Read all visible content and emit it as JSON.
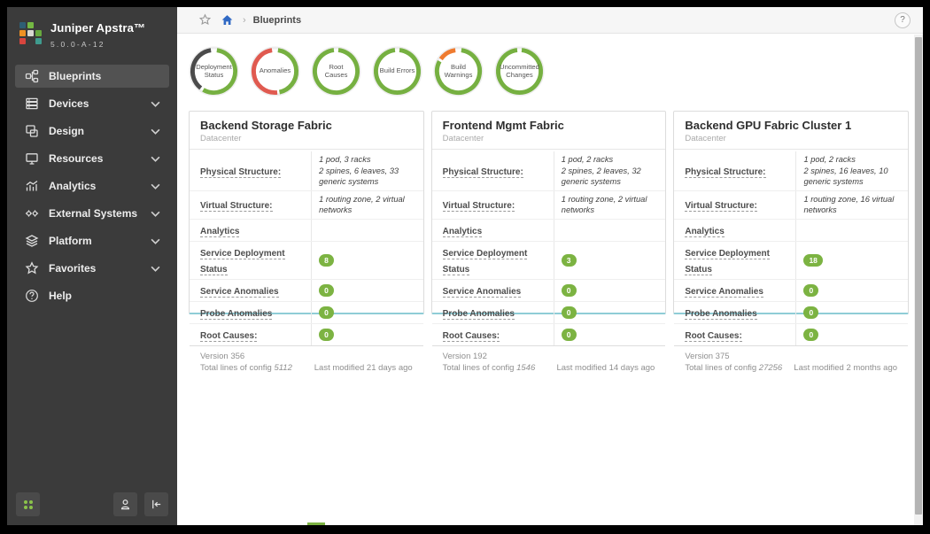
{
  "app": {
    "brand": "Juniper Apstra™",
    "version": "5.0.0-A-12"
  },
  "breadcrumb": {
    "page": "Blueprints",
    "separator": "›"
  },
  "topbar": {
    "help_label": "?"
  },
  "sidebar": {
    "items": [
      {
        "label": "Blueprints"
      },
      {
        "label": "Devices"
      },
      {
        "label": "Design"
      },
      {
        "label": "Resources"
      },
      {
        "label": "Analytics"
      },
      {
        "label": "External Systems"
      },
      {
        "label": "Platform"
      },
      {
        "label": "Favorites"
      },
      {
        "label": "Help"
      }
    ]
  },
  "colors": {
    "accent_green": "#7cb342",
    "ring_green": "#76b041",
    "ring_red": "#e05a50",
    "ring_orange": "#ef7b30",
    "ring_dark": "#4b4b4b",
    "home_blue": "#3069c4",
    "card_bottom_edge": "#8fcdd6"
  },
  "status_rings": [
    {
      "label": "Deployment Status",
      "segments": [
        {
          "color": "#76b041",
          "start": 8,
          "end": 210
        },
        {
          "color": "#4b4b4b",
          "start": 218,
          "end": 352
        }
      ]
    },
    {
      "label": "Anomalies",
      "segments": [
        {
          "color": "#76b041",
          "start": 8,
          "end": 168
        },
        {
          "color": "#e05a50",
          "start": 174,
          "end": 352
        }
      ]
    },
    {
      "label": "Root Causes",
      "segments": [
        {
          "color": "#76b041",
          "start": 6,
          "end": 354
        }
      ]
    },
    {
      "label": "Build Errors",
      "segments": [
        {
          "color": "#76b041",
          "start": 6,
          "end": 354
        }
      ]
    },
    {
      "label": "Build Warnings",
      "segments": [
        {
          "color": "#76b041",
          "start": 8,
          "end": 298
        },
        {
          "color": "#ef7b30",
          "start": 305,
          "end": 352
        }
      ]
    },
    {
      "label": "Uncommitted Changes",
      "segments": [
        {
          "color": "#76b041",
          "start": 6,
          "end": 354
        }
      ]
    }
  ],
  "cards": [
    {
      "title": "Backend Storage Fabric",
      "subtitle": "Datacenter",
      "rows": [
        {
          "label": "Physical Structure:",
          "value_lines": [
            "1 pod, 3 racks",
            "2 spines, 6 leaves, 33 generic systems"
          ]
        },
        {
          "label": "Virtual Structure:",
          "value_lines": [
            "1 routing zone, 2 virtual networks"
          ]
        },
        {
          "label": "Analytics"
        },
        {
          "label": "Service Deployment Status",
          "badge": "8"
        },
        {
          "label": "Service Anomalies",
          "badge": "0"
        },
        {
          "label": "Probe Anomalies",
          "badge": "0"
        },
        {
          "label": "Root Causes:",
          "badge": "0"
        }
      ],
      "footer": {
        "version": "Version 356",
        "config_label": "Total lines of config",
        "config_value": "5112",
        "modified": "Last modified 21 days ago"
      }
    },
    {
      "title": "Frontend Mgmt Fabric",
      "subtitle": "Datacenter",
      "rows": [
        {
          "label": "Physical Structure:",
          "value_lines": [
            "1 pod, 2 racks",
            "2 spines, 2 leaves, 32 generic systems"
          ]
        },
        {
          "label": "Virtual Structure:",
          "value_lines": [
            "1 routing zone, 2 virtual networks"
          ]
        },
        {
          "label": "Analytics"
        },
        {
          "label": "Service Deployment Status",
          "badge": "3"
        },
        {
          "label": "Service Anomalies",
          "badge": "0"
        },
        {
          "label": "Probe Anomalies",
          "badge": "0"
        },
        {
          "label": "Root Causes:",
          "badge": "0"
        }
      ],
      "footer": {
        "version": "Version 192",
        "config_label": "Total lines of config",
        "config_value": "1546",
        "modified": "Last modified 14 days ago"
      }
    },
    {
      "title": "Backend GPU Fabric Cluster 1",
      "subtitle": "Datacenter",
      "rows": [
        {
          "label": "Physical Structure:",
          "value_lines": [
            "1 pod, 2 racks",
            "2 spines, 16 leaves, 10 generic systems"
          ]
        },
        {
          "label": "Virtual Structure:",
          "value_lines": [
            "1 routing zone, 16 virtual networks"
          ]
        },
        {
          "label": "Analytics"
        },
        {
          "label": "Service Deployment Status",
          "badge": "18"
        },
        {
          "label": "Service Anomalies",
          "badge": "0"
        },
        {
          "label": "Probe Anomalies",
          "badge": "0"
        },
        {
          "label": "Root Causes:",
          "badge": "0"
        }
      ],
      "footer": {
        "version": "Version 375",
        "config_label": "Total lines of config",
        "config_value": "27256",
        "modified": "Last modified 2 months ago"
      }
    }
  ]
}
